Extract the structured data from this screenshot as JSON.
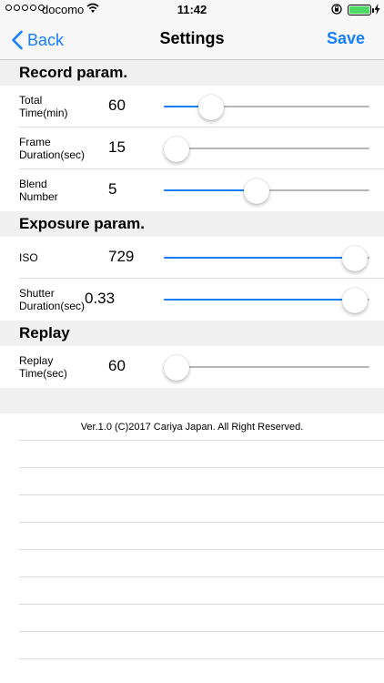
{
  "status_bar": {
    "signal_dots": 5,
    "carrier": "docomo",
    "time": "11:42",
    "battery_color": "#4cd964"
  },
  "nav": {
    "back_label": "Back",
    "title": "Settings",
    "save_label": "Save",
    "accent_color": "#147efb"
  },
  "sections": [
    {
      "title": "Record param.",
      "rows": [
        {
          "label": "Total\nTime(min)",
          "value": "60",
          "level": 0.23
        },
        {
          "label": "Frame\nDuration(sec)",
          "value": "15",
          "level": 0.06
        },
        {
          "label": "Blend\nNumber",
          "value": "5",
          "level": 0.45
        }
      ]
    },
    {
      "title": "Exposure param.",
      "rows": [
        {
          "label": "ISO",
          "value": "729",
          "level": 0.93
        },
        {
          "label": "Shutter\nDuration(sec)",
          "value": "0.33",
          "level": 0.93
        }
      ]
    },
    {
      "title": "Replay",
      "rows": [
        {
          "label": "Replay\nTime(sec)",
          "value": "60",
          "level": 0.06
        }
      ]
    }
  ],
  "footer": "Ver.1.0 (C)2017 Cariya Japan. All Right Reserved."
}
